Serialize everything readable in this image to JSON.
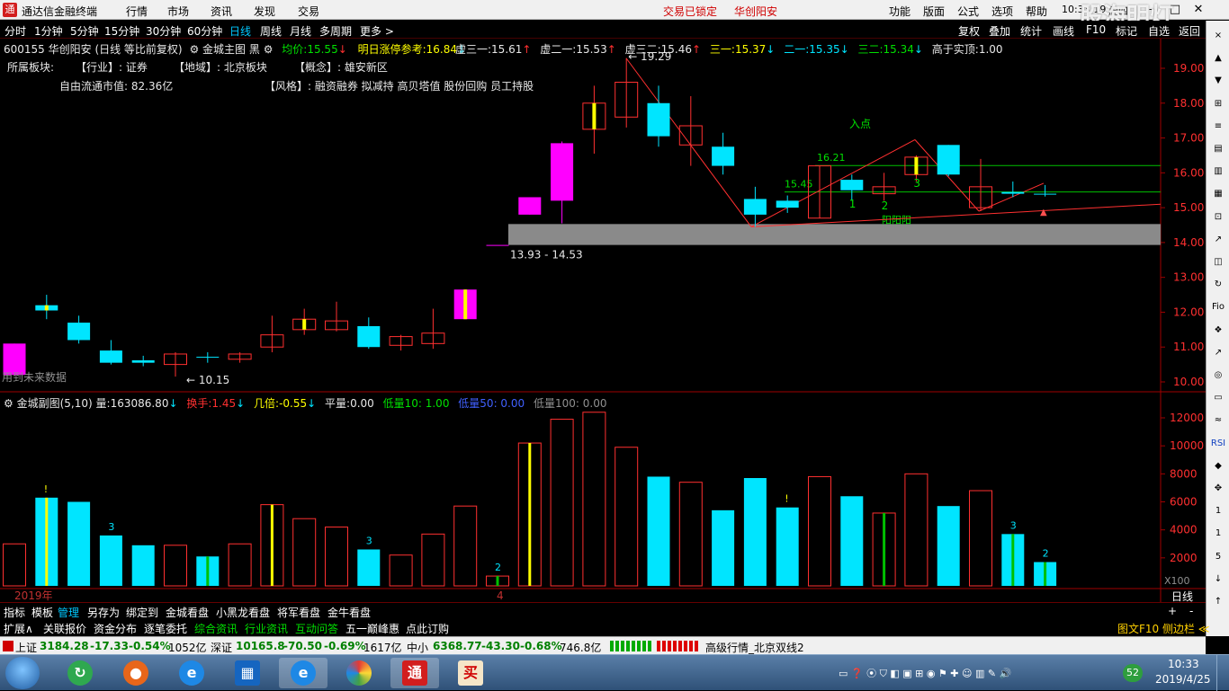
{
  "titlebar": {
    "app_title": "通达信金融终端",
    "menus": [
      "行情",
      "市场",
      "资讯",
      "发现",
      "交易"
    ],
    "lock_status": "交易已锁定",
    "stock_name_header": "华创阳安",
    "right_menus": [
      "功能",
      "版面",
      "公式",
      "选项",
      "帮助"
    ],
    "clock": "10:33:19",
    "weekday": "周四",
    "watermark": "股海明灯"
  },
  "periodbar": {
    "periods": [
      "分时",
      "1分钟",
      "5分钟",
      "15分钟",
      "30分钟",
      "60分钟",
      "日线",
      "周线",
      "月线",
      "多周期",
      "更多 >"
    ],
    "selected": "日线",
    "right_buttons": [
      "复权",
      "叠加",
      "统计",
      "画线",
      "F10",
      "标记",
      "自选",
      "返回"
    ]
  },
  "main_info": {
    "code_name": "600155 华创阳安 (日线 等比前复权)",
    "indicator_name": "金城主图 黑",
    "avg_label": "均价:",
    "avg_value": "15.55",
    "limit_label": "明日涨停参考:",
    "limit_value": "16.84",
    "levels": [
      {
        "label": "虚三一:",
        "value": "15.61",
        "color": "#e8e8e8"
      },
      {
        "label": "虚二一:",
        "value": "15.53",
        "color": "#e8e8e8"
      },
      {
        "label": "虚三二:",
        "value": "15.46",
        "color": "#e8e8e8"
      },
      {
        "label": "三一:",
        "value": "15.37",
        "color": "#ffff00"
      },
      {
        "label": "二一:",
        "value": "15.35",
        "color": "#00e5ff"
      },
      {
        "label": "三二:",
        "value": "15.34",
        "color": "#00e000"
      }
    ],
    "top_label": "高于实顶:",
    "top_value": "1.00",
    "sector_label": "所属板块:",
    "industry": "【行业】: 证券",
    "region": "【地域】: 北京板块",
    "concept": "【概念】: 雄安新区",
    "float_cap": "自由流通市值: 82.36亿",
    "style": "【风格】: 融资融券 拟减持 高贝塔值 股份回购 员工持股",
    "future_data_note": "用到未来数据"
  },
  "sub_info": {
    "indicator": "金城副图(5,10)",
    "vol_label": "量:",
    "vol_value": "163086.80",
    "turnover_label": "换手:",
    "turnover_value": "1.45",
    "ratio_label": "几倍:",
    "ratio_value": "-0.55",
    "flat_label": "平量:",
    "flat_value": "0.00",
    "low10": "低量10: 1.00",
    "low50": "低量50: 0.00",
    "low100": "低量100: 0.00",
    "x100": "X100"
  },
  "chart_data": [
    {
      "type": "candlestick",
      "title": "600155 华创阳安 日线",
      "ylim": [
        9.8,
        19.4
      ],
      "yticks": [
        "10.00",
        "11.00",
        "12.00",
        "13.00",
        "14.00",
        "15.00",
        "16.00",
        "17.00",
        "18.00",
        "19.00"
      ],
      "candles": [
        {
          "o": 11.1,
          "h": 11.1,
          "l": 10.2,
          "c": 10.2,
          "color": "magenta"
        },
        {
          "o": 12.05,
          "h": 12.5,
          "l": 11.8,
          "c": 12.2,
          "color": "cyan"
        },
        {
          "o": 11.7,
          "h": 11.9,
          "l": 11.1,
          "c": 11.2,
          "color": "cyan"
        },
        {
          "o": 10.9,
          "h": 11.2,
          "l": 10.5,
          "c": 10.55,
          "color": "cyan"
        },
        {
          "o": 10.62,
          "h": 10.75,
          "l": 10.45,
          "c": 10.55,
          "color": "cyan"
        },
        {
          "o": 10.5,
          "h": 10.85,
          "l": 10.15,
          "c": 10.8,
          "color": "red"
        },
        {
          "o": 10.7,
          "h": 10.85,
          "l": 10.55,
          "c": 10.72,
          "color": "cyan"
        },
        {
          "o": 10.65,
          "h": 10.85,
          "l": 10.55,
          "c": 10.8,
          "color": "red"
        },
        {
          "o": 11.0,
          "h": 11.9,
          "l": 10.85,
          "c": 11.35,
          "color": "red"
        },
        {
          "o": 11.5,
          "h": 12.1,
          "l": 11.35,
          "c": 11.8,
          "color": "red"
        },
        {
          "o": 11.5,
          "h": 12.3,
          "l": 11.45,
          "c": 11.75,
          "color": "red"
        },
        {
          "o": 11.6,
          "h": 11.85,
          "l": 10.95,
          "c": 11.0,
          "color": "cyan"
        },
        {
          "o": 11.05,
          "h": 11.35,
          "l": 10.9,
          "c": 11.3,
          "color": "red"
        },
        {
          "o": 11.1,
          "h": 12.1,
          "l": 10.95,
          "c": 11.4,
          "color": "red"
        },
        {
          "o": 11.8,
          "h": 12.65,
          "l": 11.8,
          "c": 12.65,
          "color": "magenta"
        },
        {
          "o": 13.93,
          "h": 13.93,
          "l": 13.93,
          "c": 13.93,
          "color": "magenta"
        },
        {
          "o": 14.8,
          "h": 15.3,
          "l": 14.8,
          "c": 15.3,
          "color": "magenta"
        },
        {
          "o": 15.2,
          "h": 16.9,
          "l": 14.55,
          "c": 16.85,
          "color": "magenta"
        },
        {
          "o": 17.25,
          "h": 18.5,
          "l": 16.55,
          "c": 18.0,
          "color": "red"
        },
        {
          "o": 17.6,
          "h": 19.29,
          "l": 17.3,
          "c": 18.6,
          "color": "red"
        },
        {
          "o": 18.0,
          "h": 18.5,
          "l": 16.75,
          "c": 17.05,
          "color": "cyan"
        },
        {
          "o": 16.8,
          "h": 18.2,
          "l": 16.2,
          "c": 17.35,
          "color": "red"
        },
        {
          "o": 16.75,
          "h": 17.15,
          "l": 15.95,
          "c": 16.2,
          "color": "cyan"
        },
        {
          "o": 15.25,
          "h": 15.6,
          "l": 14.45,
          "c": 14.8,
          "color": "cyan"
        },
        {
          "o": 15.2,
          "h": 15.35,
          "l": 14.85,
          "c": 15.0,
          "color": "cyan"
        },
        {
          "o": 14.7,
          "h": 16.21,
          "l": 14.7,
          "c": 16.2,
          "color": "red"
        },
        {
          "o": 15.8,
          "h": 15.95,
          "l": 15.2,
          "c": 15.5,
          "color": "cyan"
        },
        {
          "o": 15.4,
          "h": 16.0,
          "l": 15.2,
          "c": 15.6,
          "color": "red"
        },
        {
          "o": 15.95,
          "h": 16.5,
          "l": 15.75,
          "c": 16.45,
          "color": "red"
        },
        {
          "o": 16.8,
          "h": 16.8,
          "l": 15.9,
          "c": 15.95,
          "color": "cyan"
        },
        {
          "o": 15.0,
          "h": 16.4,
          "l": 14.9,
          "c": 15.6,
          "color": "red"
        },
        {
          "o": 15.45,
          "h": 15.75,
          "l": 15.3,
          "c": 15.4,
          "color": "cyan"
        },
        {
          "o": 15.4,
          "h": 15.65,
          "l": 15.32,
          "c": 15.38,
          "color": "cyan"
        }
      ],
      "annotations": [
        "19.29",
        "10.15",
        "13.93 - 14.53",
        "16.21",
        "15.45",
        "入点",
        "阳阳阳",
        "1",
        "2",
        "3"
      ],
      "zone": [
        13.93,
        14.53
      ]
    },
    {
      "type": "bar",
      "title": "金城副图(5,10)",
      "ylim": [
        0,
        13000
      ],
      "yticks": [
        "2000",
        "4000",
        "6000",
        "8000",
        "10000",
        "12000"
      ],
      "values": [
        3000,
        6300,
        6000,
        3600,
        2900,
        2900,
        2100,
        3000,
        5800,
        4800,
        4200,
        2600,
        2200,
        3700,
        5700,
        700,
        10200,
        11900,
        12400,
        9900,
        7800,
        7400,
        5400,
        7700,
        5600,
        7800,
        6400,
        5200,
        8000,
        5700,
        6800,
        3700,
        1700
      ],
      "colors": [
        "red",
        "cyan",
        "cyan",
        "cyan",
        "cyan",
        "red",
        "cyan",
        "red",
        "red",
        "red",
        "red",
        "cyan",
        "red",
        "red",
        "red",
        "red",
        "red",
        "red",
        "red",
        "red",
        "cyan",
        "red",
        "cyan",
        "cyan",
        "cyan",
        "red",
        "cyan",
        "red",
        "red",
        "cyan",
        "red",
        "cyan",
        "cyan"
      ],
      "marks": [
        "!",
        "3",
        "3",
        "2",
        "!",
        "3",
        "2"
      ],
      "xlabels": [
        "2019年",
        "4"
      ]
    }
  ],
  "tabbar1": [
    "指标",
    "模板",
    "管理",
    "另存为",
    "绑定到",
    "金城看盘",
    "小黑龙看盘",
    "将军看盘",
    "金牛看盘"
  ],
  "tabbar1_right": [
    "+",
    "-"
  ],
  "axis_mode": "日线",
  "tabbar2": [
    "扩展∧",
    "关联报价",
    "资金分布",
    "逐笔委托",
    "综合资讯",
    "行业资讯",
    "互动问答",
    "五一巅峰惠",
    "点此订购"
  ],
  "tabbar2_right": "图文F10 侧边栏 ≪",
  "statusbar": {
    "sh_name": "上证",
    "sh_value": "3184.28",
    "sh_change": "-17.33",
    "sh_pct": "-0.54%",
    "sh_amount": "1052亿",
    "sz_name": "深证",
    "sz_value": "10165.8",
    "sz_change": "-70.50",
    "sz_pct": "-0.69%",
    "sz_amount": "1617亿",
    "zx_name": "中小",
    "zx_value": "6368.77",
    "zx_change": "-43.30",
    "zx_pct": "-0.68%",
    "zx_amount": "746.8亿",
    "feed": "高级行情_北京双线2"
  },
  "taskbar": {
    "time": "10:33",
    "date": "2019/4/25",
    "badge": "52",
    "buy_label": "买"
  }
}
